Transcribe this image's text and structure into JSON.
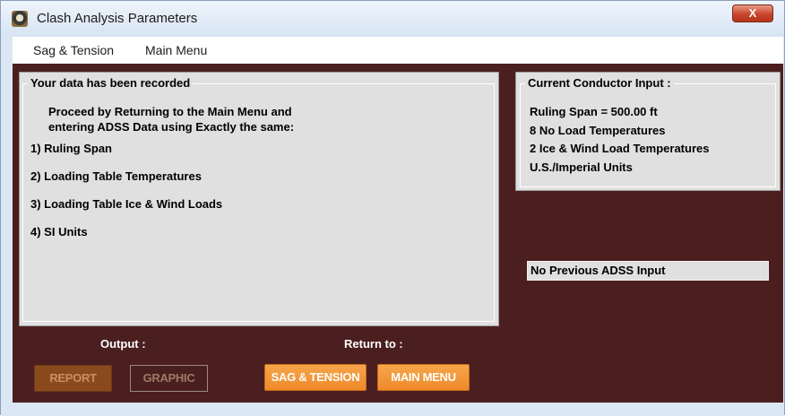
{
  "window": {
    "title": "Clash Analysis Parameters",
    "close_glyph": "X"
  },
  "menu": {
    "items": [
      "Sag & Tension",
      "Main Menu"
    ]
  },
  "left_panel": {
    "legend": "Your data has been recorded",
    "intro_line1": "Proceed by Returning to the Main Menu and",
    "intro_line2": "entering ADSS Data using Exactly the same:",
    "items": [
      "1)  Ruling Span",
      "2)  Loading Table Temperatures",
      "3)  Loading Table  Ice & Wind Loads",
      "4)  SI Units"
    ]
  },
  "right_panel": {
    "legend": "Current Conductor Input :",
    "lines": [
      "Ruling Span = 500.00 ft",
      "8 No Load Temperatures",
      "2 Ice & Wind Load Temperatures",
      "U.S./Imperial Units"
    ]
  },
  "adss_status": "No Previous ADSS Input",
  "output": {
    "label": "Output :",
    "report": "REPORT",
    "graphic": "GRAPHIC"
  },
  "return_to": {
    "label": "Return to :",
    "sag_tension": "SAG & TENSION",
    "main_menu": "MAIN MENU"
  }
}
